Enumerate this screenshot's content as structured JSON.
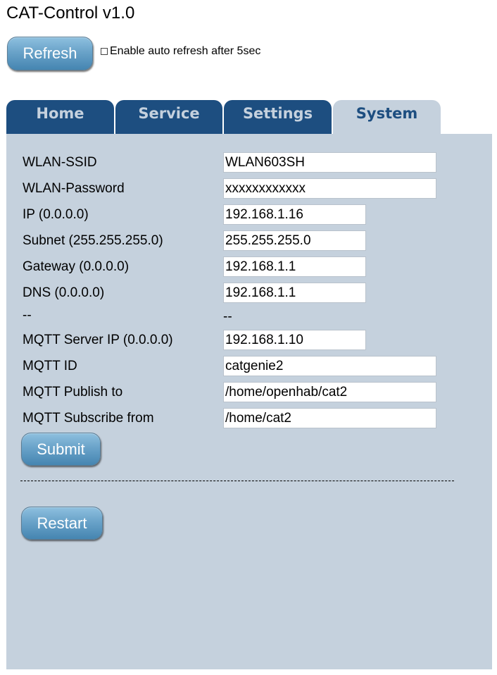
{
  "app": {
    "title": "CAT-Control v1.0"
  },
  "toolbar": {
    "refresh_label": "Refresh",
    "auto_refresh_label": "Enable auto refresh after 5sec",
    "auto_refresh_checked": false
  },
  "tabs": [
    {
      "label": "Home",
      "active": false
    },
    {
      "label": "Service",
      "active": false
    },
    {
      "label": "Settings",
      "active": false
    },
    {
      "label": "System",
      "active": true
    }
  ],
  "form": {
    "fields": [
      {
        "label": "WLAN-SSID",
        "value": "WLAN603SH"
      },
      {
        "label": "WLAN-Password",
        "value": "xxxxxxxxxxxx"
      },
      {
        "label": "IP (0.0.0.0)",
        "value": "192.168.1.16"
      },
      {
        "label": "Subnet (255.255.255.0)",
        "value": "255.255.255.0"
      },
      {
        "label": "Gateway (0.0.0.0)",
        "value": "192.168.1.1"
      },
      {
        "label": "DNS (0.0.0.0)",
        "value": "192.168.1.1"
      },
      {
        "label": "MQTT Server IP (0.0.0.0)",
        "value": "192.168.1.10"
      },
      {
        "label": "MQTT ID",
        "value": "catgenie2"
      },
      {
        "label": "MQTT Publish to",
        "value": "/home/openhab/cat2"
      },
      {
        "label": "MQTT Subscribe from",
        "value": "/home/cat2"
      }
    ],
    "separator_label": "--",
    "separator_value": "--",
    "submit_label": "Submit",
    "restart_label": "Restart"
  },
  "colors": {
    "tab_bg": "#1d4e80",
    "tab_text": "#c5d1de",
    "panel_bg": "#c5d1dd",
    "button_top": "#8ec0df",
    "button_bottom": "#4585b1"
  }
}
